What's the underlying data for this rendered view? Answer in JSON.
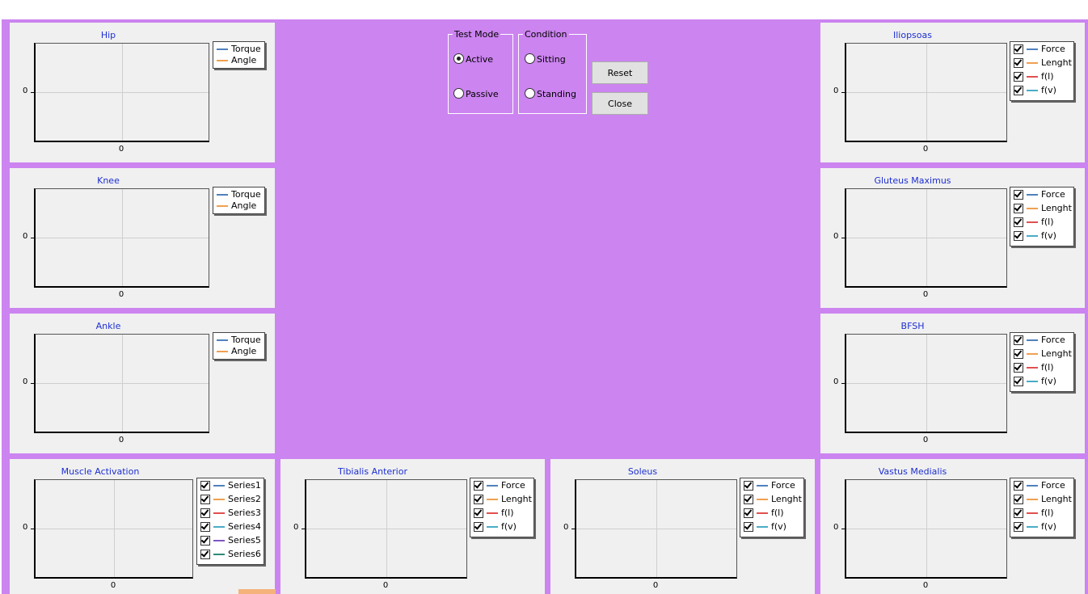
{
  "controls": {
    "test_mode": {
      "title": "Test Mode",
      "options": [
        "Active",
        "Passive"
      ],
      "selected": "Active"
    },
    "condition": {
      "title": "Condition",
      "options": [
        "Sitting",
        "Standing"
      ],
      "selected": ""
    },
    "reset_label": "Reset",
    "close_label": "Close"
  },
  "colors": {
    "workspace": "#cc84f0",
    "panel": "#f0f0f0",
    "title": "#1d2fd0",
    "series": [
      "#4f81bd",
      "#f0a050",
      "#e05050",
      "#4bacc6",
      "#7e57c2",
      "#2e8b7a"
    ]
  },
  "charts": [
    {
      "id": "hip",
      "title": "Hip",
      "legend_style": "plain",
      "legend": [
        "Torque",
        "Angle"
      ],
      "y_tick": "0",
      "x_tick": "0"
    },
    {
      "id": "knee",
      "title": "Knee",
      "legend_style": "plain",
      "legend": [
        "Torque",
        "Angle"
      ],
      "y_tick": "0",
      "x_tick": "0"
    },
    {
      "id": "ankle",
      "title": "Ankle",
      "legend_style": "plain",
      "legend": [
        "Torque",
        "Angle"
      ],
      "y_tick": "0",
      "x_tick": "0"
    },
    {
      "id": "muscle-activation",
      "title": "Muscle Activation",
      "legend_style": "checkbox",
      "legend": [
        "Series1",
        "Series2",
        "Series3",
        "Series4",
        "Series5",
        "Series6"
      ],
      "y_tick": "0",
      "x_tick": "0"
    },
    {
      "id": "tibialis-anterior",
      "title": "Tibialis Anterior",
      "legend_style": "checkbox",
      "legend": [
        "Force",
        "Lenght",
        "f(l)",
        "f(v)"
      ],
      "y_tick": "0",
      "x_tick": "0"
    },
    {
      "id": "soleus",
      "title": "Soleus",
      "legend_style": "checkbox",
      "legend": [
        "Force",
        "Lenght",
        "f(l)",
        "f(v)"
      ],
      "y_tick": "0",
      "x_tick": "0"
    },
    {
      "id": "iliopsoas",
      "title": "Iliopsoas",
      "legend_style": "checkbox",
      "legend": [
        "Force",
        "Lenght",
        "f(l)",
        "f(v)"
      ],
      "y_tick": "0",
      "x_tick": "0"
    },
    {
      "id": "gluteus-maximus",
      "title": "Gluteus Maximus",
      "legend_style": "checkbox",
      "legend": [
        "Force",
        "Lenght",
        "f(l)",
        "f(v)"
      ],
      "y_tick": "0",
      "x_tick": "0"
    },
    {
      "id": "bfsh",
      "title": "BFSH",
      "legend_style": "checkbox",
      "legend": [
        "Force",
        "Lenght",
        "f(l)",
        "f(v)"
      ],
      "y_tick": "0",
      "x_tick": "0"
    },
    {
      "id": "vastus-medialis",
      "title": "Vastus Medialis",
      "legend_style": "checkbox",
      "legend": [
        "Force",
        "Lenght",
        "f(l)",
        "f(v)"
      ],
      "y_tick": "0",
      "x_tick": "0"
    }
  ]
}
